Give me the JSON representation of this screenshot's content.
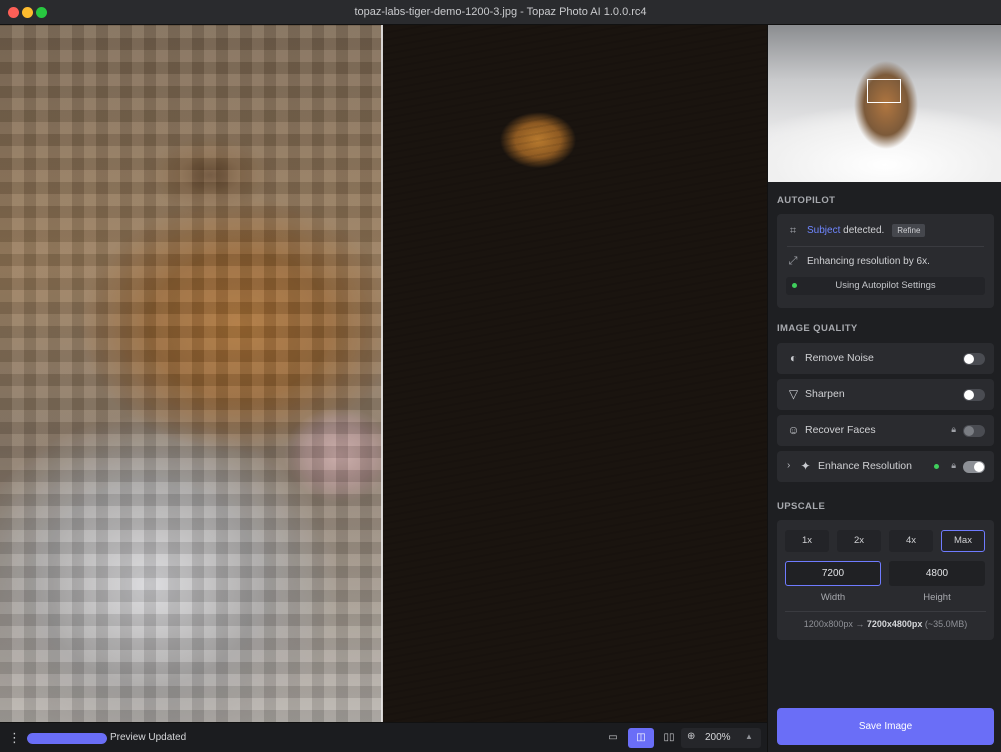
{
  "window": {
    "title": "topaz-labs-tiger-demo-1200-3.jpg - Topaz Photo AI 1.0.0.rc4"
  },
  "autopilot": {
    "section_label": "AUTOPILOT",
    "subject_word": "Subject",
    "detected_text": " detected.",
    "refine_label": "Refine",
    "enhancing_text": "Enhancing resolution by 6x.",
    "settings_text": "Using Autopilot Settings"
  },
  "image_quality": {
    "section_label": "IMAGE QUALITY",
    "items": [
      {
        "label": "Remove Noise",
        "icon": "noise-icon",
        "enabled": false,
        "locked": false
      },
      {
        "label": "Sharpen",
        "icon": "sharpen-icon",
        "enabled": false,
        "locked": false
      },
      {
        "label": "Recover Faces",
        "icon": "face-icon",
        "enabled": false,
        "locked": true
      },
      {
        "label": "Enhance Resolution",
        "icon": "sparkle-icon",
        "enabled": true,
        "locked": true
      }
    ]
  },
  "upscale": {
    "section_label": "UPSCALE",
    "presets": [
      "1x",
      "2x",
      "4x",
      "Max"
    ],
    "selected_preset": "Max",
    "width_value": "7200",
    "height_value": "4800",
    "width_label": "Width",
    "height_label": "Height",
    "info_from": "1200x800px",
    "info_arrow": " → ",
    "info_to": "7200x4800px",
    "info_size": " (~35.0MB)"
  },
  "actions": {
    "save_label": "Save Image"
  },
  "status": {
    "progress_fraction": 1.0,
    "text": "Preview Updated",
    "zoom": "200%",
    "view_modes": [
      "single-view",
      "split-view",
      "side-by-side-view"
    ],
    "active_view": "split-view"
  },
  "colors": {
    "accent": "#6a6ef7",
    "link": "#6f86ff",
    "status_green": "#3fcf5c"
  }
}
